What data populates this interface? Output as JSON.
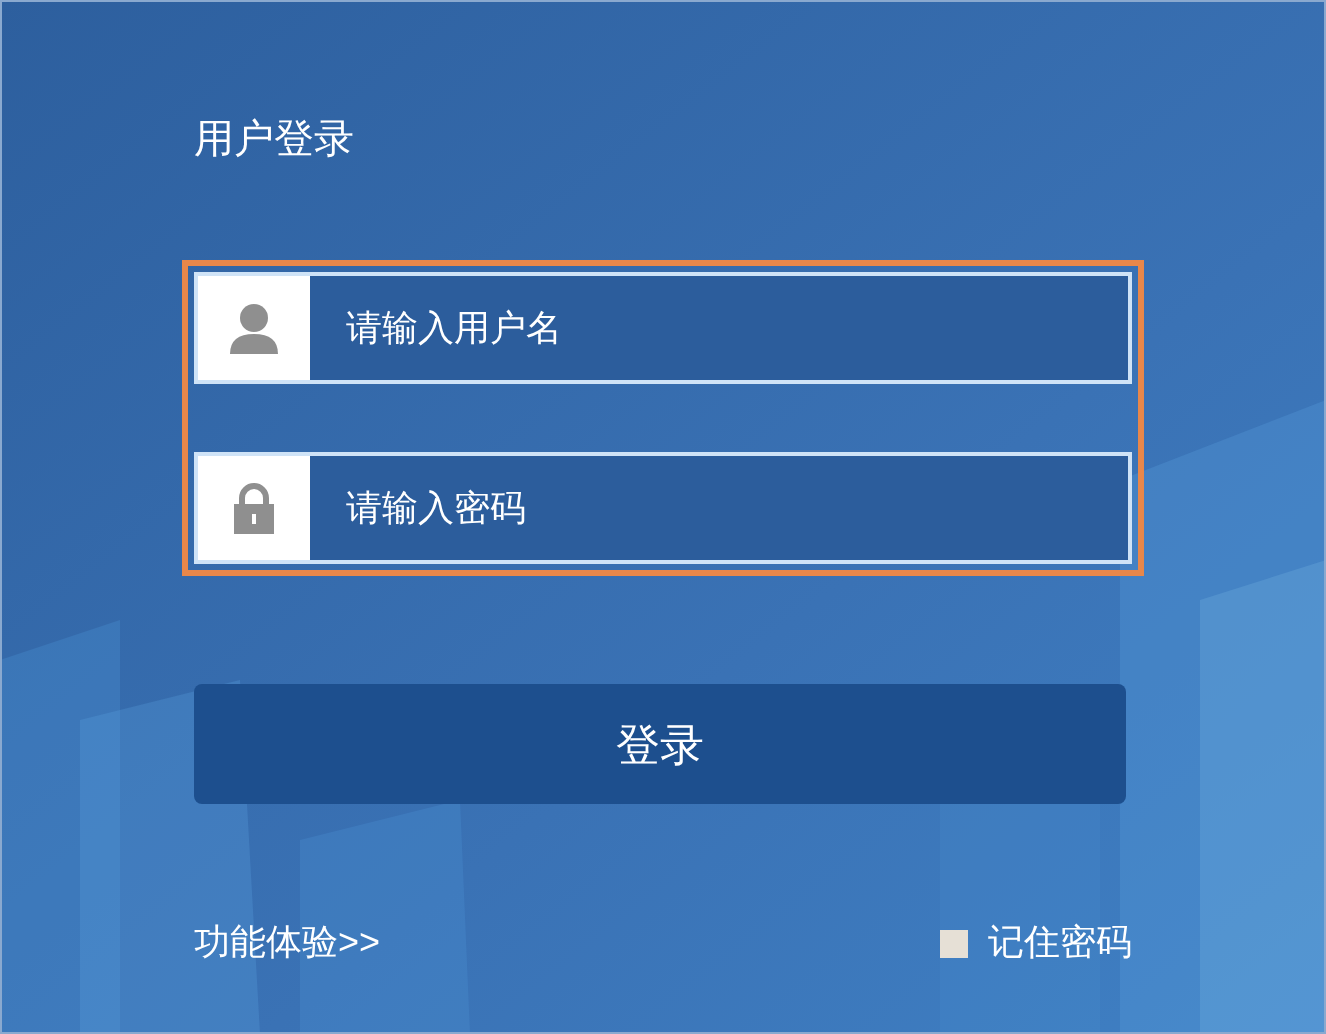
{
  "title": "用户登录",
  "fields": [
    {
      "kind": "user",
      "placeholder": "请输入用户名"
    },
    {
      "kind": "password",
      "placeholder": "请输入密码"
    }
  ],
  "login_button": "登录",
  "trial_link": "功能体验>>",
  "remember": {
    "label": "记住密码",
    "checked": false
  }
}
